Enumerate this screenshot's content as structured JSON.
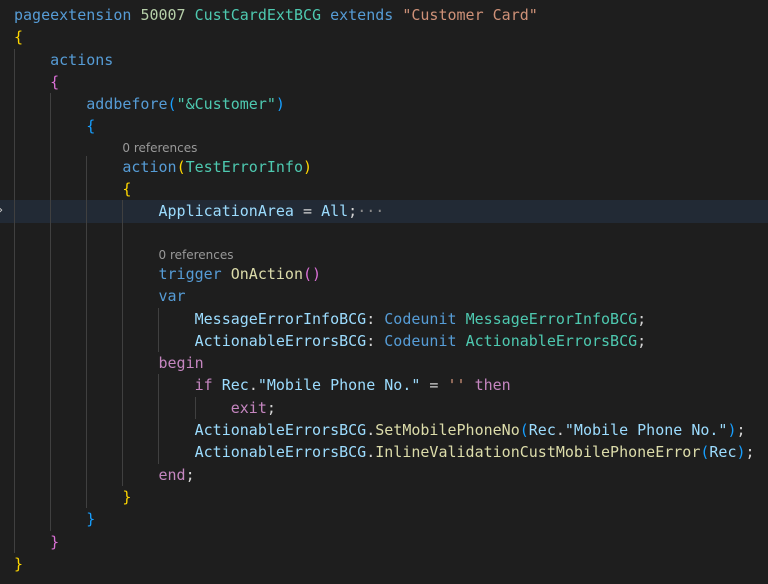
{
  "editor": {
    "theme_colors": {
      "background": "#1e1e1e",
      "keyword": "#569cd6",
      "control": "#c586c0",
      "type": "#4ec9b0",
      "number": "#b5cea8",
      "string": "#ce9178",
      "identifier": "#9cdcfe",
      "function": "#dcdcaa",
      "bracket1": "#ffd700",
      "bracket2": "#da70d6",
      "bracket3": "#179fff"
    },
    "lines": [
      {
        "codelens": "0 references",
        "lead": ""
      },
      {
        "tokens": [
          [
            "pageextension",
            "kw"
          ],
          [
            " ",
            "p"
          ],
          [
            "50007",
            "num"
          ],
          [
            " ",
            "p"
          ],
          [
            "CustCardExtBCG",
            "ty"
          ],
          [
            " ",
            "p"
          ],
          [
            "extends",
            "kw"
          ],
          [
            " ",
            "p"
          ],
          [
            "\"Customer Card\"",
            "str"
          ]
        ]
      },
      {
        "tokens": [
          [
            "{",
            "b1"
          ]
        ]
      },
      {
        "tokens": [
          [
            "    ",
            "p"
          ],
          [
            "actions",
            "kw"
          ]
        ]
      },
      {
        "tokens": [
          [
            "    ",
            "p"
          ],
          [
            "{",
            "b2"
          ]
        ]
      },
      {
        "tokens": [
          [
            "        ",
            "p"
          ],
          [
            "addbefore",
            "kw"
          ],
          [
            "(",
            "b3"
          ],
          [
            "\"&Customer\"",
            "ty"
          ],
          [
            ")",
            "b3"
          ]
        ]
      },
      {
        "tokens": [
          [
            "        ",
            "p"
          ],
          [
            "{",
            "b3"
          ]
        ]
      },
      {
        "codelens": "0 references",
        "lead": "            "
      },
      {
        "tokens": [
          [
            "            ",
            "p"
          ],
          [
            "action",
            "kw"
          ],
          [
            "(",
            "b1"
          ],
          [
            "TestErrorInfo",
            "ty"
          ],
          [
            ")",
            "b1"
          ]
        ]
      },
      {
        "tokens": [
          [
            "            ",
            "p"
          ],
          [
            "{",
            "b1"
          ]
        ]
      },
      {
        "active": true,
        "folded": true,
        "tokens": [
          [
            "                ",
            "p"
          ],
          [
            "ApplicationArea",
            "id"
          ],
          [
            " = ",
            "p"
          ],
          [
            "All",
            "id"
          ],
          [
            ";",
            "p"
          ],
          [
            "···",
            "ellipsis"
          ]
        ]
      },
      {
        "tokens": [
          [
            "                ",
            "p"
          ]
        ]
      },
      {
        "codelens": "0 references",
        "lead": "                "
      },
      {
        "tokens": [
          [
            "                ",
            "p"
          ],
          [
            "trigger",
            "kw"
          ],
          [
            " ",
            "p"
          ],
          [
            "OnAction",
            "fn"
          ],
          [
            "()",
            "b2"
          ]
        ]
      },
      {
        "tokens": [
          [
            "                ",
            "p"
          ],
          [
            "var",
            "kw"
          ]
        ]
      },
      {
        "tokens": [
          [
            "                    ",
            "p"
          ],
          [
            "MessageErrorInfoBCG",
            "id"
          ],
          [
            ": ",
            "p"
          ],
          [
            "Codeunit",
            "kw"
          ],
          [
            " ",
            "p"
          ],
          [
            "MessageErrorInfoBCG",
            "ty"
          ],
          [
            ";",
            "p"
          ]
        ]
      },
      {
        "tokens": [
          [
            "                    ",
            "p"
          ],
          [
            "ActionableErrorsBCG",
            "id"
          ],
          [
            ": ",
            "p"
          ],
          [
            "Codeunit",
            "kw"
          ],
          [
            " ",
            "p"
          ],
          [
            "ActionableErrorsBCG",
            "ty"
          ],
          [
            ";",
            "p"
          ]
        ]
      },
      {
        "tokens": [
          [
            "                ",
            "p"
          ],
          [
            "begin",
            "ctl"
          ]
        ]
      },
      {
        "tokens": [
          [
            "                    ",
            "p"
          ],
          [
            "if",
            "ctl"
          ],
          [
            " ",
            "p"
          ],
          [
            "Rec",
            "id"
          ],
          [
            ".",
            "p"
          ],
          [
            "\"Mobile Phone No.\"",
            "id"
          ],
          [
            " = ",
            "p"
          ],
          [
            "''",
            "str"
          ],
          [
            " ",
            "p"
          ],
          [
            "then",
            "ctl"
          ]
        ]
      },
      {
        "tokens": [
          [
            "                        ",
            "p"
          ],
          [
            "exit",
            "ctl"
          ],
          [
            ";",
            "p"
          ]
        ]
      },
      {
        "tokens": [
          [
            "                    ",
            "p"
          ],
          [
            "ActionableErrorsBCG",
            "id"
          ],
          [
            ".",
            "p"
          ],
          [
            "SetMobilePhoneNo",
            "fn"
          ],
          [
            "(",
            "b3"
          ],
          [
            "Rec",
            "id"
          ],
          [
            ".",
            "p"
          ],
          [
            "\"Mobile Phone No.\"",
            "id"
          ],
          [
            ")",
            "b3"
          ],
          [
            ";",
            "p"
          ]
        ]
      },
      {
        "tokens": [
          [
            "                    ",
            "p"
          ],
          [
            "ActionableErrorsBCG",
            "id"
          ],
          [
            ".",
            "p"
          ],
          [
            "InlineValidationCustMobilePhoneError",
            "fn"
          ],
          [
            "(",
            "b3"
          ],
          [
            "Rec",
            "id"
          ],
          [
            ")",
            "b3"
          ],
          [
            ";",
            "p"
          ]
        ]
      },
      {
        "tokens": [
          [
            "                ",
            "p"
          ],
          [
            "end",
            "ctl"
          ],
          [
            ";",
            "p"
          ]
        ]
      },
      {
        "tokens": [
          [
            "            ",
            "p"
          ],
          [
            "}",
            "b1"
          ]
        ]
      },
      {
        "tokens": [
          [
            "        ",
            "p"
          ],
          [
            "}",
            "b3"
          ]
        ]
      },
      {
        "tokens": [
          [
            "    ",
            "p"
          ],
          [
            "}",
            "b2"
          ]
        ]
      },
      {
        "tokens": [
          [
            "}",
            "b1"
          ]
        ]
      }
    ]
  }
}
